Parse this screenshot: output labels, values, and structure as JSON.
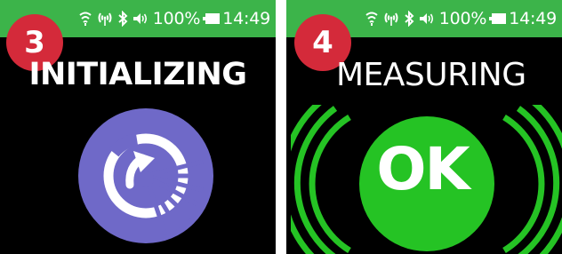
{
  "panels": [
    {
      "status_bar": {
        "battery": "100%",
        "time": "14:49",
        "icons": [
          "wifi-icon",
          "signal-icon",
          "bluetooth-icon",
          "volume-icon",
          "battery-icon"
        ]
      },
      "step_number": "3",
      "title": "INITIALIZING",
      "indicator_icon": "initializing-progress-icon",
      "colors": {
        "status_bar": "#3cb44a",
        "badge": "#d42a3a",
        "indicator": "#6f69c8"
      }
    },
    {
      "status_bar": {
        "battery": "100%",
        "time": "14:49",
        "icons": [
          "wifi-icon",
          "signal-icon",
          "bluetooth-icon",
          "volume-icon",
          "battery-icon"
        ]
      },
      "step_number": "4",
      "title": "MEASURING",
      "indicator_label": "OK",
      "indicator_icon": "ok-signal-icon",
      "colors": {
        "status_bar": "#3cb44a",
        "badge": "#d42a3a",
        "indicator": "#25c324"
      }
    }
  ]
}
